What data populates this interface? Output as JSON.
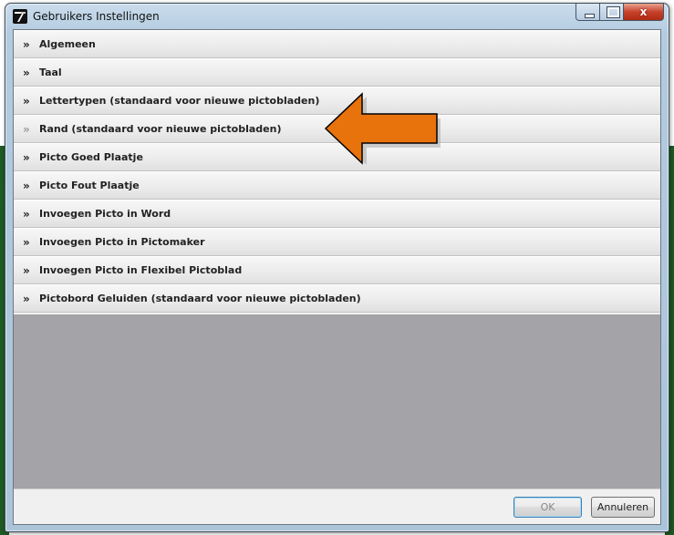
{
  "window": {
    "title": "Gebruikers Instellingen",
    "close_glyph": "x"
  },
  "panels": [
    {
      "chevron": "»",
      "label": "Algemeen"
    },
    {
      "chevron": "»",
      "label": "Taal"
    },
    {
      "chevron": "»",
      "label": "Lettertypen (standaard voor nieuwe pictobladen)"
    },
    {
      "chevron": "»",
      "label": "Rand (standaard voor nieuwe pictobladen)"
    },
    {
      "chevron": "»",
      "label": "Picto Goed Plaatje"
    },
    {
      "chevron": "»",
      "label": "Picto Fout Plaatje"
    },
    {
      "chevron": "»",
      "label": "Invoegen Picto in Word"
    },
    {
      "chevron": "»",
      "label": "Invoegen Picto in Pictomaker"
    },
    {
      "chevron": "»",
      "label": "Invoegen Picto in Flexibel Pictoblad"
    },
    {
      "chevron": "»",
      "label": "Pictobord Geluiden (standaard voor nieuwe pictobladen)"
    }
  ],
  "buttons": {
    "ok_label": "OK",
    "cancel_label": "Annuleren"
  },
  "colors": {
    "arrow": "#e8720c",
    "close_button": "#c7422b"
  },
  "icons": {
    "app": "app-logo-icon",
    "annotation": "orange-left-arrow"
  }
}
